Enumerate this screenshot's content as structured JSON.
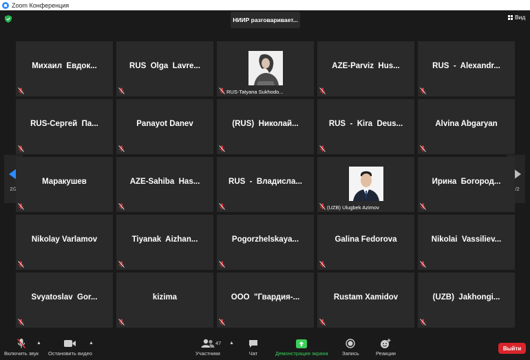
{
  "window": {
    "title": "Zoom Конференция"
  },
  "header": {
    "speaker": "НИИР разговаривает...",
    "view_label": "Вид"
  },
  "pagination": {
    "left": "2/2",
    "right": "2/2"
  },
  "tiles": [
    {
      "name": "Михаил  Евдок...",
      "video": false
    },
    {
      "name": "RUS  Olga  Lavre...",
      "video": false
    },
    {
      "name": "RUS-Tatyana Sukhodo...",
      "video": true,
      "photo": "woman-photo"
    },
    {
      "name": "AZE-Parviz  Hus...",
      "video": false
    },
    {
      "name": "RUS  -  Alexandr...",
      "video": false
    },
    {
      "name": "RUS-Сергей  Па...",
      "video": false
    },
    {
      "name": "Panayot Danev",
      "video": false
    },
    {
      "name": "(RUS)  Николай...",
      "video": false
    },
    {
      "name": "RUS  -  Kira  Deus...",
      "video": false
    },
    {
      "name": "Alvina Abgaryan",
      "video": false
    },
    {
      "name": "Маракушев",
      "video": false
    },
    {
      "name": "AZE-Sahiba  Has...",
      "video": false
    },
    {
      "name": "RUS  -  Владисла...",
      "video": false
    },
    {
      "name": "(UZB) Ulugbek Azimov",
      "video": true,
      "photo": "man-photo"
    },
    {
      "name": "Ирина  Богород...",
      "video": false
    },
    {
      "name": "Nikolay Varlamov",
      "video": false
    },
    {
      "name": "Tiyanak  Aizhan...",
      "video": false
    },
    {
      "name": "Pogorzhelskaya...",
      "video": false
    },
    {
      "name": "Galina Fedorova",
      "video": false
    },
    {
      "name": "Nikolai  Vassiliev...",
      "video": false
    },
    {
      "name": "Svyatoslav  Gor...",
      "video": false
    },
    {
      "name": "kizima",
      "video": false
    },
    {
      "name": "ООО  \"Гвардия-...",
      "video": false
    },
    {
      "name": "Rustam Xamidov",
      "video": false
    },
    {
      "name": "(UZB)  Jakhongi...",
      "video": false
    }
  ],
  "toolbar": {
    "unmute_label": "Включить звук",
    "start_video_label": "Остановить видео",
    "participants_label": "Участники",
    "participants_count": "47",
    "chat_label": "Чат",
    "share_label": "Демонстрация экрана",
    "record_label": "Запись",
    "reactions_label": "Реакции",
    "leave_label": "Выйти"
  },
  "colors": {
    "accent_green": "#3ccf5a",
    "leave_red": "#d9252a",
    "muted_red": "#e0353a",
    "arrow_blue": "#2d8cff"
  }
}
